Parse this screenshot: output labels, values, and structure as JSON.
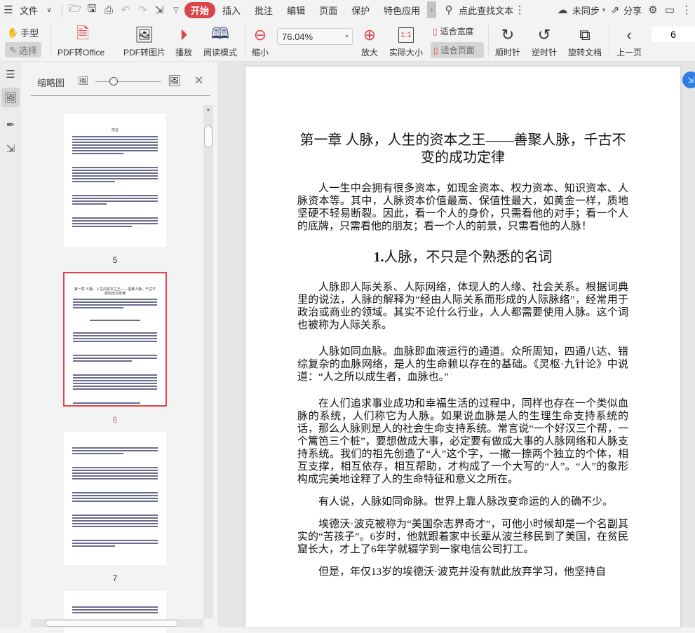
{
  "menubar": {
    "file": "文件",
    "tabs": [
      "开始",
      "插入",
      "批注",
      "编辑",
      "页面",
      "保护",
      "特色应用"
    ],
    "search": "点此查找文本",
    "sync": "未同步",
    "share": "分享"
  },
  "toolbar": {
    "hand": "手型",
    "select": "选择",
    "pdf_to_office": "PDF转Office",
    "pdf_to_image": "PDF转图片",
    "play": "播放",
    "read_mode": "阅读模式",
    "zoom_out": "缩小",
    "zoom_value": "76.04%",
    "zoom_in": "放大",
    "actual_size": "实际大小",
    "fit_width": "适合宽度",
    "fit_page": "适合页面",
    "clockwise": "顺时针",
    "counterclockwise": "逆时针",
    "rotate_doc": "旋转文档",
    "prev_page": "上一页",
    "page_number": "6"
  },
  "thumbnails": {
    "title": "缩略图",
    "pages": [
      {
        "label": "5",
        "heading": "前言"
      },
      {
        "label": "6",
        "heading": "第一章 人脉，人生的资本之王——善聚人脉，千古不变的成功定律",
        "selected": true
      },
      {
        "label": "7"
      }
    ],
    "selected_color": "#e0454b"
  },
  "document": {
    "title": "第一章 人脉，人生的资本之王——善聚人脉，千古不变的成功定律",
    "intro": "人一生中会拥有很多资本，如现金资本、权力资本、知识资本、人脉资本等。其中，人脉资本价值最高、保值性最大，如黄金一样，质地坚硬不轻易断裂。因此，看一个人的身价，只需看他的对手；看一个人的底牌，只需看他的朋友；看一个人的前景，只需看他的人脉！",
    "section_num": "1.",
    "section_title": "人脉，不只是个熟悉的名词",
    "paragraphs": [
      "人脉即人际关系、人际网络，体现人的人缘、社会关系。根据词典里的说法，人脉的解释为“经由人际关系而形成的人际脉络”，经常用于政治或商业的领域。其实不论什么行业，人人都需要使用人脉。这个词也被称为人际关系。",
      "人脉如同血脉。血脉即血液运行的通道。众所周知，四通八达、错综复杂的血脉网络，是人的生命赖以存在的基础。《灵枢·九针论》中说道：“人之所以成生者，血脉也。”",
      "在人们追求事业成功和幸福生活的过程中，同样也存在一个类似血脉的系统，人们称它为人脉。如果说血脉是人的生理生命支持系统的话，那么人脉则是人的社会生命支持系统。常言说“一个好汉三个帮，一个篱笆三个桩”，要想做成大事，必定要有做成大事的人脉网络和人脉支持系统。我们的祖先创造了“人”这个字，一撇一捺两个独立的个体，相互支撑，相互依存，相互帮助，才构成了一个大写的“人”。“人”的象形构成完美地诠释了人的生命特征和意义之所在。",
      "有人说，人脉如同命脉。世界上靠人脉改变命运的人的确不少。",
      "埃德沃·波克被称为“美国杂志界奇才”，可他小时候却是一个名副其实的“苦孩子”。6岁时，他就跟着家中长辈从波兰移民到了美国，在贫民窟长大，才上了6年学就辍学到一家电信公司打工。",
      "但是，年仅13岁的埃德沃·波克并没有就此放弃学习，他坚持自"
    ]
  },
  "colors": {
    "accent": "#d9464a",
    "float_button": "#2f7de1"
  }
}
